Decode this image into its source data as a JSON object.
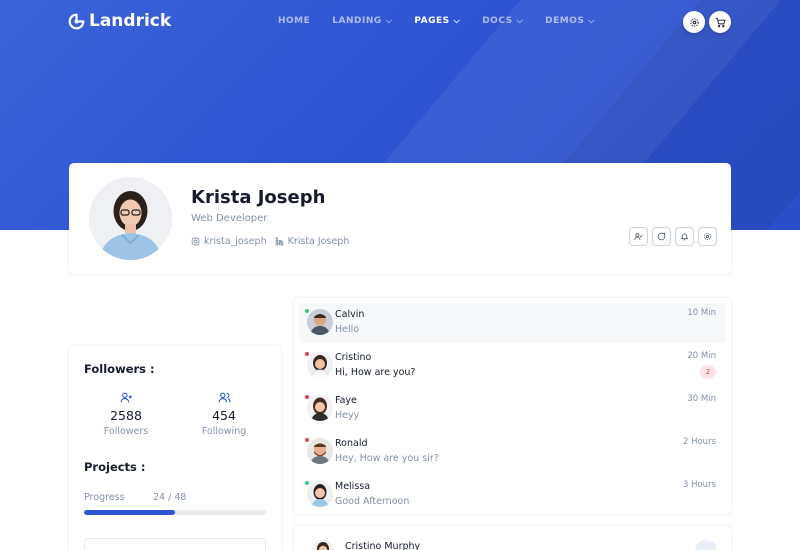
{
  "brand": {
    "name": "Landrick"
  },
  "nav": {
    "items": [
      {
        "label": "HOME",
        "dropdown": false,
        "active": false
      },
      {
        "label": "LANDING",
        "dropdown": true,
        "active": false
      },
      {
        "label": "PAGES",
        "dropdown": true,
        "active": true
      },
      {
        "label": "DOCS",
        "dropdown": true,
        "active": false
      },
      {
        "label": "DEMOS",
        "dropdown": true,
        "active": false
      }
    ],
    "settings_icon": "gear-icon",
    "cart_icon": "cart-icon"
  },
  "colors": {
    "primary": "#2f55d4",
    "online": "#2eca8b",
    "offline": "#e43f52",
    "heading": "#161c2d",
    "muted": "#8492a6"
  },
  "profile": {
    "name": "Krista Joseph",
    "role": "Web Developer",
    "instagram": "krista_joseph",
    "linkedin": "Krista Joseph",
    "actions": [
      "user-check-icon",
      "message-icon",
      "bell-icon",
      "gear-icon"
    ]
  },
  "followers": {
    "title": "Followers :",
    "followers_count": "2588",
    "followers_label": "Followers",
    "following_count": "454",
    "following_label": "Following"
  },
  "projects": {
    "title": "Projects :",
    "progress_label": "Progress",
    "progress_value": "24 / 48",
    "progress_fraction": 0.5
  },
  "chats": [
    {
      "name": "Calvin",
      "message": "Hello",
      "time": "10 Min",
      "status": "online",
      "unread": false,
      "badge": "",
      "selected": true
    },
    {
      "name": "Cristino",
      "message": "Hi, How are you?",
      "time": "20 Min",
      "status": "offline",
      "unread": true,
      "badge": "2",
      "selected": false
    },
    {
      "name": "Faye",
      "message": "Heyy",
      "time": "30 Min",
      "status": "offline",
      "unread": false,
      "badge": "",
      "selected": false
    },
    {
      "name": "Ronald",
      "message": "Hey, How are you sir?",
      "time": "2 Hours",
      "status": "offline",
      "unread": false,
      "badge": "",
      "selected": false
    },
    {
      "name": "Melissa",
      "message": "Good Afternoon",
      "time": "3 Hours",
      "status": "online",
      "unread": false,
      "badge": "",
      "selected": false
    }
  ],
  "chat_header": {
    "name": "Cristino Murphy"
  }
}
